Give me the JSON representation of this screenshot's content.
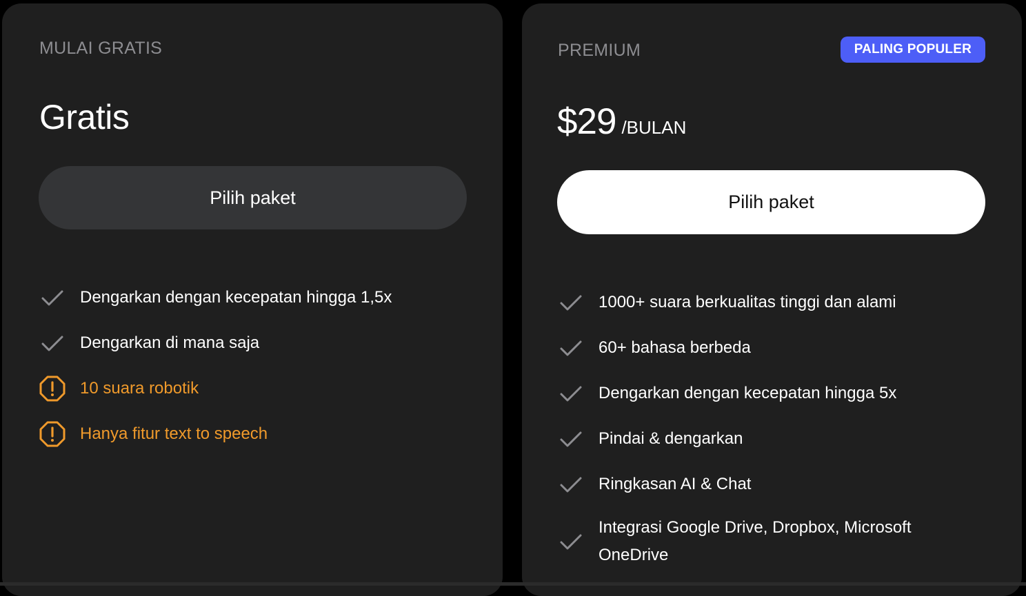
{
  "free_plan": {
    "label": "MULAI GRATIS",
    "price": "Gratis",
    "button_label": "Pilih paket",
    "features": [
      {
        "text": "Dengarkan dengan kecepatan hingga 1,5x",
        "icon": "check-icon",
        "type": "included"
      },
      {
        "text": "Dengarkan di mana saja",
        "icon": "check-icon",
        "type": "included"
      },
      {
        "text": "10 suara robotik",
        "icon": "warning-icon",
        "type": "limitation"
      },
      {
        "text": "Hanya fitur text to speech",
        "icon": "warning-icon",
        "type": "limitation"
      }
    ]
  },
  "premium_plan": {
    "label": "PREMIUM",
    "badge": "PALING POPULER",
    "price": "$29",
    "period": "/BULAN",
    "button_label": "Pilih paket",
    "features": [
      {
        "text": "1000+ suara berkualitas tinggi dan alami",
        "icon": "check-icon",
        "type": "included"
      },
      {
        "text": "60+ bahasa berbeda",
        "icon": "check-icon",
        "type": "included"
      },
      {
        "text": "Dengarkan dengan kecepatan hingga 5x",
        "icon": "check-icon",
        "type": "included"
      },
      {
        "text": "Pindai & dengarkan",
        "icon": "check-icon",
        "type": "included"
      },
      {
        "text": "Ringkasan AI & Chat",
        "icon": "check-icon",
        "type": "included"
      },
      {
        "text": "Integrasi Google Drive, Dropbox, Microsoft OneDrive",
        "icon": "check-icon",
        "type": "included"
      }
    ]
  },
  "colors": {
    "page_background": "#000000",
    "card_background": "#1f1f1f",
    "free_button": "#343537",
    "premium_button": "#ffffff",
    "badge": "#4d5ef7",
    "warning": "#f09a2b",
    "check": "#8d8d91"
  }
}
